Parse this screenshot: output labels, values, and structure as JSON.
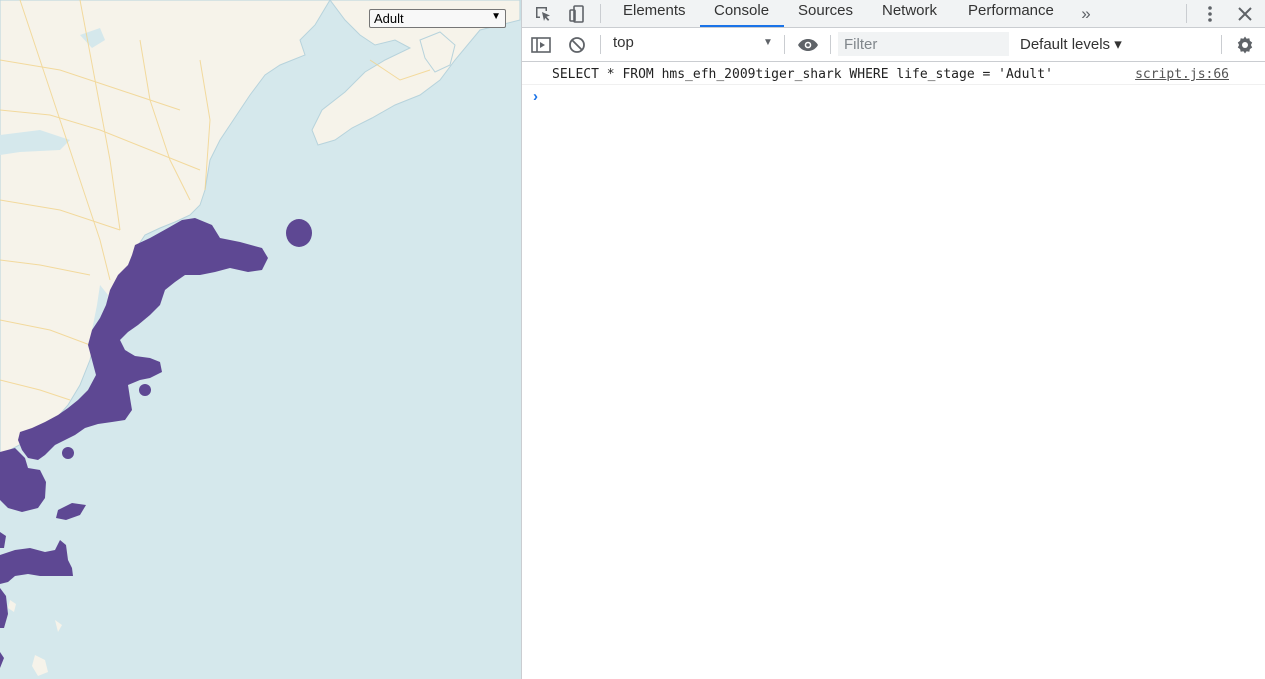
{
  "map": {
    "life_stage_select": {
      "selected": "Adult"
    },
    "colors": {
      "water": "#d5e8ec",
      "land": "#f6f3ea",
      "habitat": "#5e4893"
    }
  },
  "devtools": {
    "tabs": [
      {
        "label": "Elements",
        "active": false
      },
      {
        "label": "Console",
        "active": true
      },
      {
        "label": "Sources",
        "active": false
      },
      {
        "label": "Network",
        "active": false
      },
      {
        "label": "Performance",
        "active": false
      }
    ],
    "more_tabs_icon": "chevron-double-right",
    "toolbar": {
      "context": "top",
      "filter_placeholder": "Filter",
      "levels_label": "Default levels ▾"
    },
    "console": {
      "messages": [
        {
          "text": "SELECT * FROM hms_efh_2009tiger_shark WHERE life_stage = 'Adult'",
          "source": "script.js:66"
        }
      ],
      "prompt_symbol": "›"
    },
    "accent_color": "#1a73e8"
  }
}
